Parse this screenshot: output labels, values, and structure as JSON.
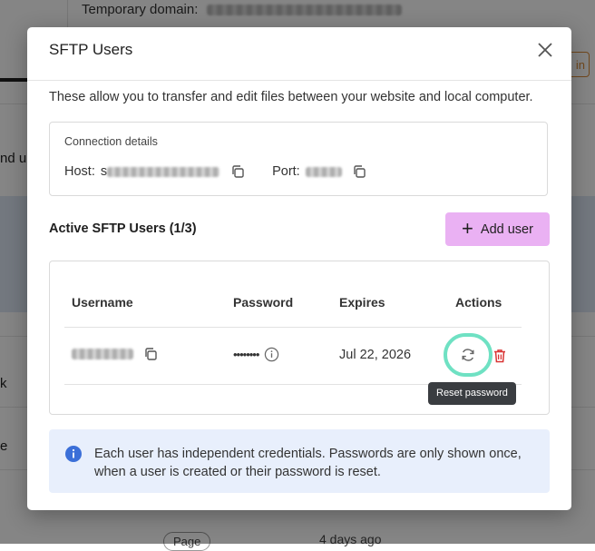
{
  "background": {
    "temp_domain_label": "Temporary domain:",
    "login_partial": "in",
    "left_partial_1": "nd u",
    "left_partial_2": "k",
    "left_partial_3": "e",
    "pill_label": "Page",
    "time_ago": "4 days ago"
  },
  "modal": {
    "title": "SFTP Users",
    "description": "These allow you to transfer and edit files between your website and local computer.",
    "connection": {
      "title": "Connection details",
      "host_label": "Host:",
      "host_prefix": "s",
      "port_label": "Port:"
    },
    "users_section": {
      "title": "Active SFTP Users (1/3)",
      "add_button": "Add user"
    },
    "table": {
      "columns": [
        "Username",
        "Password",
        "Expires",
        "Actions"
      ],
      "rows": [
        {
          "password_masked": "••••••••",
          "expires": "Jul 22, 2026"
        }
      ]
    },
    "tooltip": "Reset password",
    "info_note": "Each user has independent credentials. Passwords are only shown once, when a user is created or their password is reset."
  },
  "colors": {
    "accent_button": "#eab1f3",
    "highlight_ring": "#6fe1c3",
    "info_bg": "#e8effc",
    "info_icon": "#3b6fd8",
    "delete": "#d93434"
  },
  "icons": {
    "close": "close-icon",
    "copy": "copy-icon",
    "reset": "refresh-icon",
    "delete": "trash-icon",
    "info": "info-icon"
  }
}
